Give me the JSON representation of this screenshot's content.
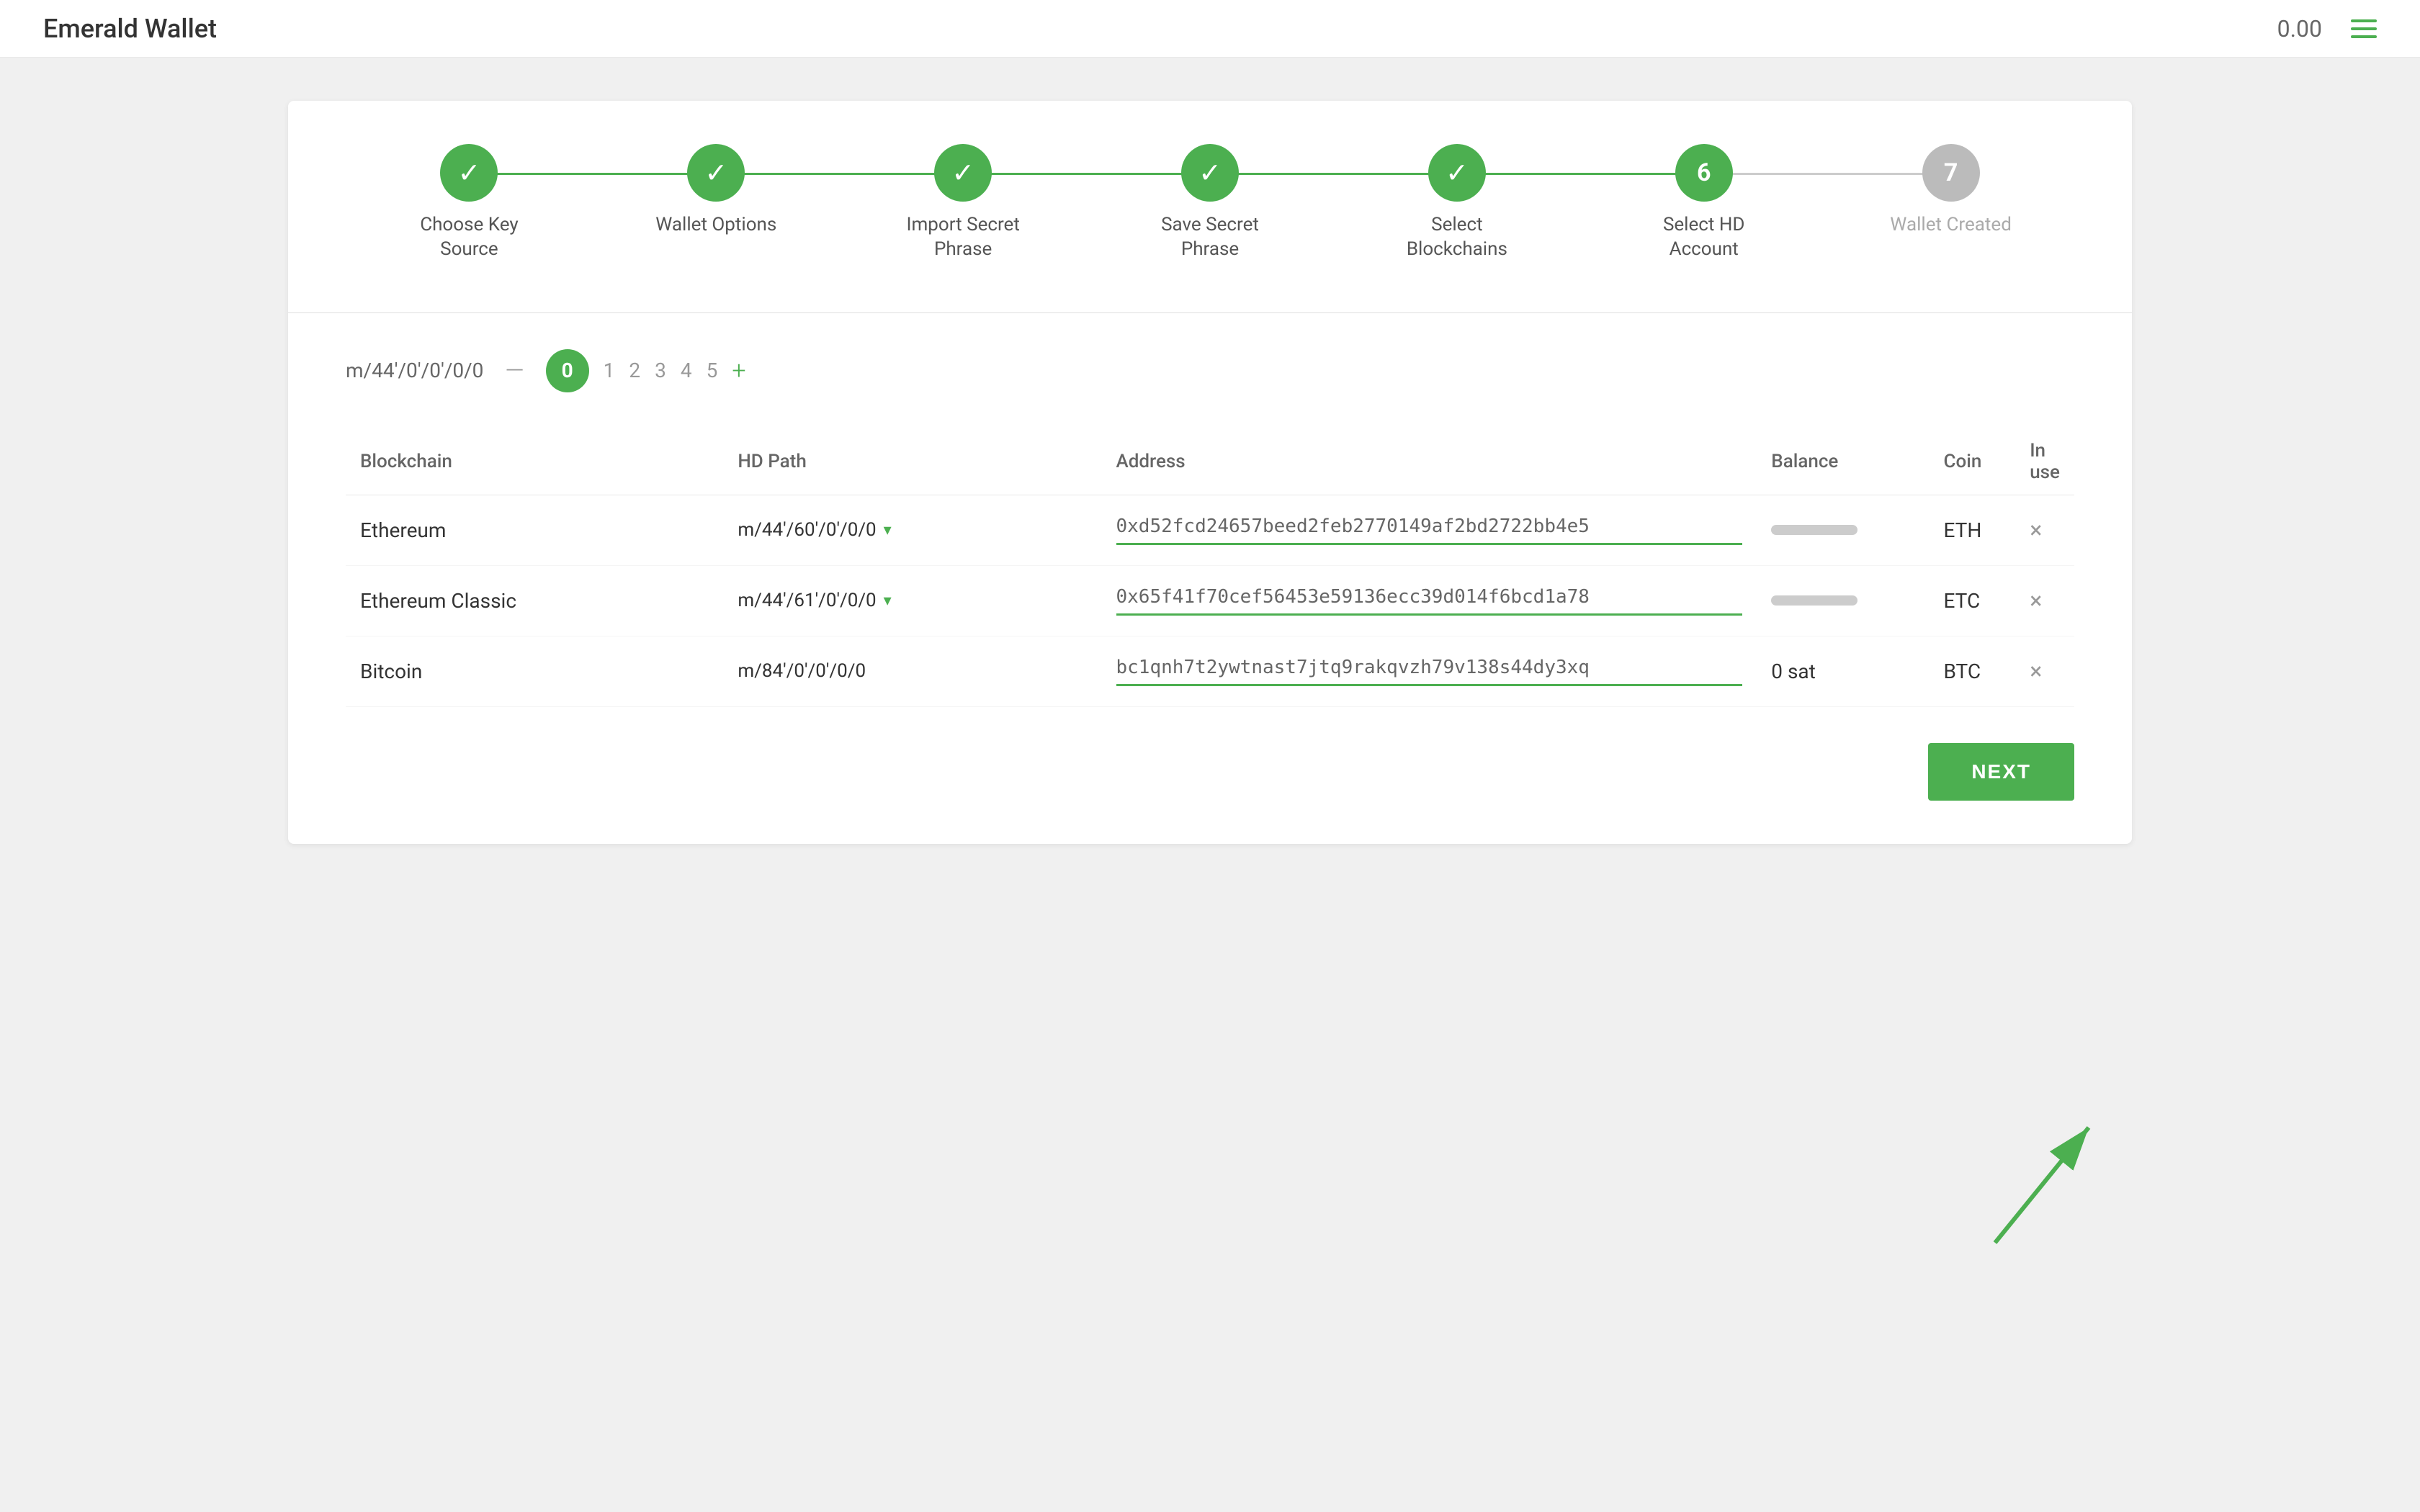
{
  "header": {
    "logo_green": "Emerald",
    "logo_rest": " Wallet",
    "balance": "0.00",
    "menu_icon_label": "menu"
  },
  "stepper": {
    "steps": [
      {
        "id": 1,
        "label": "Choose Key Source",
        "status": "complete",
        "icon": "✓"
      },
      {
        "id": 2,
        "label": "Wallet Options",
        "status": "complete",
        "icon": "✓"
      },
      {
        "id": 3,
        "label": "Import Secret Phrase",
        "status": "complete",
        "icon": "✓"
      },
      {
        "id": 4,
        "label": "Save Secret Phrase",
        "status": "complete",
        "icon": "✓"
      },
      {
        "id": 5,
        "label": "Select Blockchains",
        "status": "complete",
        "icon": "✓"
      },
      {
        "id": 6,
        "label": "Select HD Account",
        "status": "current",
        "number": "6"
      },
      {
        "id": 7,
        "label": "Wallet Created",
        "status": "incomplete",
        "number": "7"
      }
    ]
  },
  "hd_path": {
    "label": "m/44'/0'/0'/0/0",
    "minus": "—",
    "active_index": "0",
    "indexes": [
      "1",
      "2",
      "3",
      "4",
      "5"
    ],
    "plus": "+"
  },
  "table": {
    "headers": [
      "Blockchain",
      "HD Path",
      "Address",
      "Balance",
      "Coin",
      "In use"
    ],
    "rows": [
      {
        "blockchain": "Ethereum",
        "hd_path": "m/44'/60'/0'/0/0",
        "address": "0xd52fcd24657beed2feb2770149af2bd2722bb4e5",
        "balance_type": "bar",
        "coin": "ETH",
        "close": "×"
      },
      {
        "blockchain": "Ethereum Classic",
        "hd_path": "m/44'/61'/0'/0/0",
        "address": "0x65f41f70cef56453e59136ecc39d014f6bcd1a78",
        "balance_type": "bar",
        "coin": "ETC",
        "close": "×"
      },
      {
        "blockchain": "Bitcoin",
        "hd_path": "m/84'/0'/0'/0/0",
        "address": "bc1qnh7t2ywtnast7jtq9rakqvzh79v138s44dy3xq",
        "balance_text": "0 sat",
        "balance_type": "text",
        "coin": "BTC",
        "close": "×"
      }
    ]
  },
  "next_button": {
    "label": "NEXT"
  }
}
